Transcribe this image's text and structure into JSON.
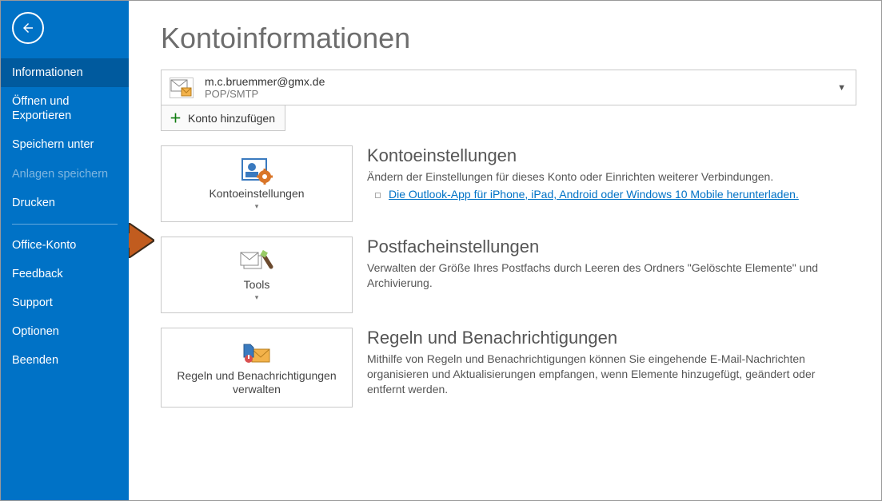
{
  "sidebar": {
    "items": [
      {
        "label": "Informationen",
        "active": true
      },
      {
        "label": "Öffnen und Exportieren"
      },
      {
        "label": "Speichern unter"
      },
      {
        "label": "Anlagen speichern",
        "disabled": true
      },
      {
        "label": "Drucken"
      },
      {
        "label": "Office-Konto"
      },
      {
        "label": "Feedback"
      },
      {
        "label": "Support"
      },
      {
        "label": "Optionen"
      },
      {
        "label": "Beenden"
      }
    ]
  },
  "page": {
    "title": "Kontoinformationen"
  },
  "account": {
    "email": "m.c.bruemmer@gmx.de",
    "type": "POP/SMTP",
    "add_label": "Konto hinzufügen"
  },
  "sections": {
    "settings": {
      "tile": "Kontoeinstellungen",
      "heading": "Kontoeinstellungen",
      "desc": "Ändern der Einstellungen für dieses Konto oder Einrichten weiterer Verbindungen.",
      "link": "Die Outlook-App für iPhone, iPad, Android oder Windows 10 Mobile herunterladen."
    },
    "mailbox": {
      "tile": "Tools",
      "heading": "Postfacheinstellungen",
      "desc": "Verwalten der Größe Ihres Postfachs durch Leeren des Ordners \"Gelöschte Elemente\" und Archivierung."
    },
    "rules": {
      "tile": "Regeln und Benachrichtigungen verwalten",
      "heading": "Regeln und Benachrichtigungen",
      "desc": "Mithilfe von Regeln und Benachrichtigungen können Sie eingehende E-Mail-Nachrichten organisieren und Aktualisierungen empfangen, wenn Elemente hinzugefügt, geändert oder entfernt werden."
    }
  }
}
